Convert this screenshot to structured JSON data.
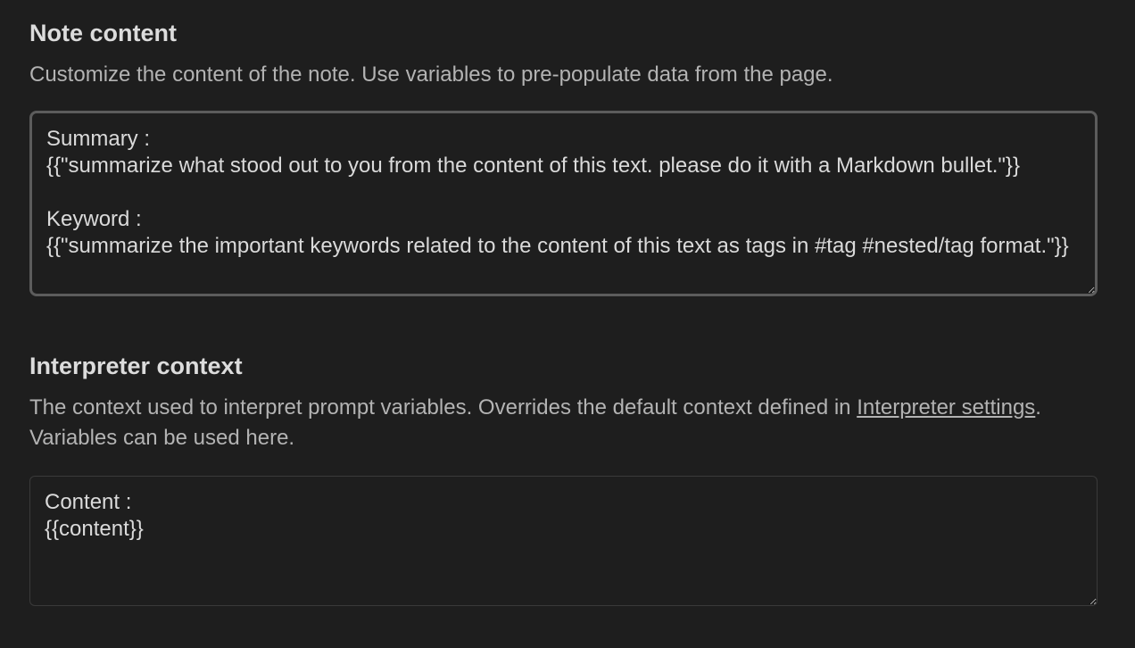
{
  "note_content": {
    "title": "Note content",
    "description": "Customize the content of the note. Use variables to pre-populate data from the page.",
    "value": "Summary :\n{{\"summarize what stood out to you from the content of this text. please do it with a Markdown bullet.\"}}\n\nKeyword :\n{{\"summarize the important keywords related to the content of this text as tags in #tag #nested/tag format.\"}}"
  },
  "interpreter_context": {
    "title": "Interpreter context",
    "description_before": "The context used to interpret prompt variables. Overrides the default context defined in ",
    "link": "Interpreter settings",
    "description_after": ". Variables can be used here.",
    "value": "Content :\n{{content}}"
  }
}
